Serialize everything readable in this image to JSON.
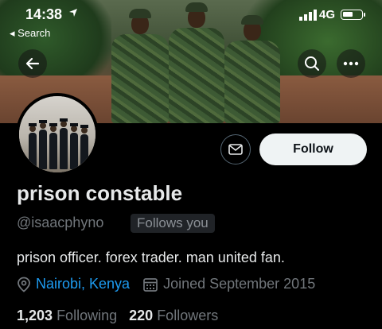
{
  "status_bar": {
    "time": "14:38",
    "back_app": "Search",
    "network": "4G"
  },
  "profile": {
    "display_name": "prison constable",
    "handle": "@isaacphyno",
    "follows_you": "Follows you",
    "bio": "prison officer. forex trader. man united fan.",
    "location": "Nairobi, Kenya",
    "joined": "Joined September 2015",
    "following_count": "1,203",
    "following_label": "Following",
    "followers_count": "220",
    "followers_label": "Followers"
  },
  "actions": {
    "follow_label": "Follow"
  },
  "icons": {
    "back": "arrow-left-icon",
    "search": "search-icon",
    "more": "more-icon",
    "message": "envelope-icon",
    "location": "location-pin-icon",
    "calendar": "calendar-icon"
  },
  "colors": {
    "accent": "#1d9bf0",
    "background": "#000000",
    "muted": "#71767b"
  }
}
